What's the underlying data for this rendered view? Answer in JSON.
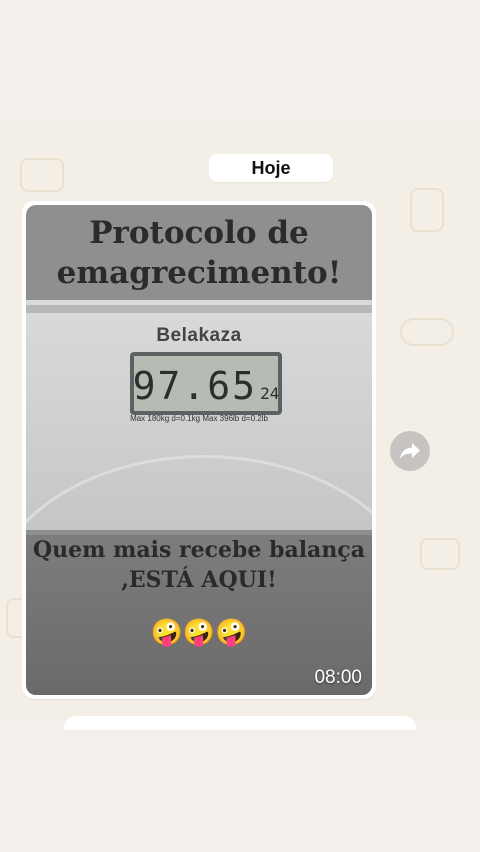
{
  "date_chip": "Hoje",
  "message": {
    "headline": "Protocolo de emagrecimento!",
    "scale": {
      "brand": "Belakaza",
      "display_main": "97.65",
      "display_small": "24",
      "specs": "Max 180kg d=0.1kg Max 396lb d=0.2lb"
    },
    "caption": "Quem mais recebe balança ,ESTÁ AQUI!",
    "emojis": "🤪🤪🤪",
    "time": "08:00"
  },
  "icons": {
    "forward": "forward-arrow-icon"
  },
  "colors": {
    "chat_background": "#f4efe6",
    "bubble": "#ffffff",
    "forward_button": "#c7c3c0"
  }
}
